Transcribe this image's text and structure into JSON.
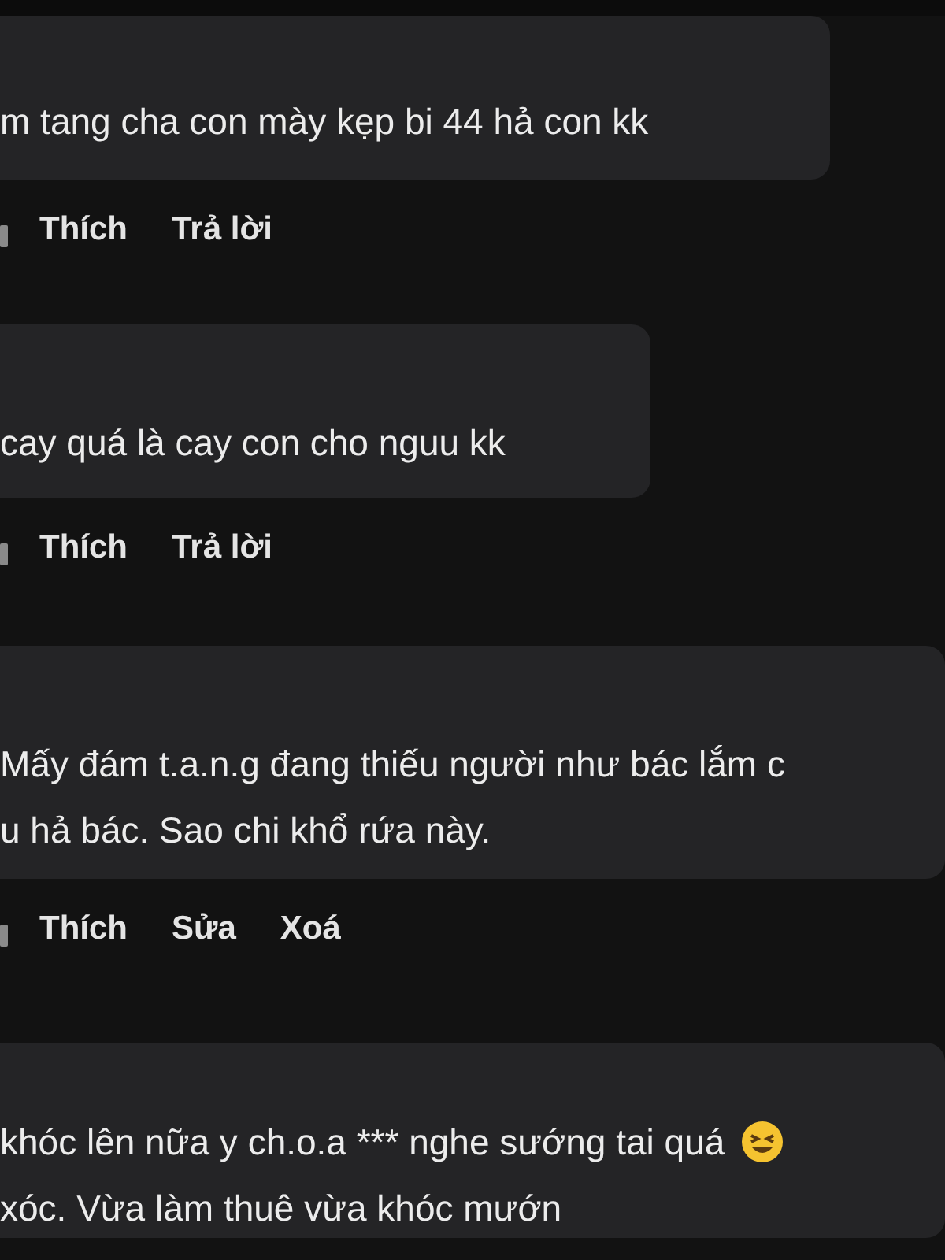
{
  "comments": [
    {
      "lines": [
        "m tang cha con mày kẹp bi 44 hả con kk"
      ],
      "actions": [
        "Thích",
        "Trả lời"
      ]
    },
    {
      "lines": [
        "cay quá là cay con cho nguu kk"
      ],
      "actions": [
        "Thích",
        "Trả lời"
      ]
    },
    {
      "lines": [
        "Mấy đám t.a.n.g đang thiếu người như bác lắm c",
        "u hả bác. Sao chi khổ rứa này."
      ],
      "actions": [
        "Thích",
        "Sửa",
        "Xoá"
      ]
    },
    {
      "lines": [
        "khóc lên nữa y ch.o.a *** nghe sướng tai quá",
        "xóc. Vừa làm thuê vừa khóc mướn"
      ],
      "emoji": true
    }
  ]
}
